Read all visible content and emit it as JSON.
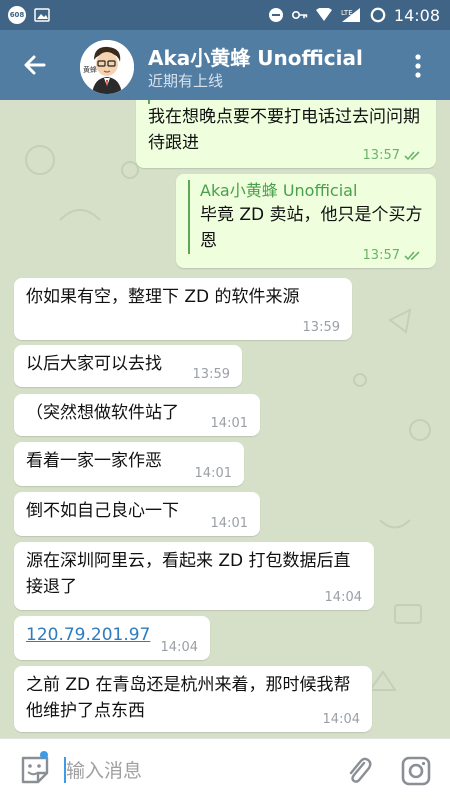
{
  "status_bar": {
    "badge": "608",
    "network": "LTE",
    "time": "14:08"
  },
  "header": {
    "title": "Aka小黄蜂 Unofficial",
    "subtitle": "近期有上线",
    "avatar_label": "黄蜂"
  },
  "messages": [
    {
      "direction": "out",
      "text": "我在想晚点要不要打电话过去问问期待跟进",
      "time": "13:57",
      "status": "read"
    },
    {
      "direction": "out",
      "reply_to": "Aka小黄蜂 Unofficial",
      "text": "毕竟 ZD 卖站，他只是个买方恩",
      "time": "13:57",
      "status": "read"
    },
    {
      "direction": "in",
      "text": "你如果有空，整理下 ZD 的软件来源",
      "time": "13:59"
    },
    {
      "direction": "in",
      "text": "以后大家可以去找",
      "time": "13:59"
    },
    {
      "direction": "in",
      "text": "（突然想做软件站了",
      "time": "14:01"
    },
    {
      "direction": "in",
      "text": "看着一家一家作恶",
      "time": "14:01"
    },
    {
      "direction": "in",
      "text": "倒不如自己良心一下",
      "time": "14:01"
    },
    {
      "direction": "in",
      "text": "源在深圳阿里云，看起来 ZD 打包数据后直接退了",
      "time": "14:04"
    },
    {
      "direction": "in",
      "text": "120.79.201.97",
      "time": "14:04",
      "is_link": true
    },
    {
      "direction": "in",
      "text": "之前 ZD 在青岛还是杭州来着，那时候我帮他维护了点东西",
      "time": "14:04"
    }
  ],
  "composer": {
    "placeholder": "输入消息"
  },
  "colors": {
    "status_bar": "#3f6485",
    "app_bar": "#527da3",
    "chat_bg": "#d6e0c9",
    "outgoing_bubble": "#efffde",
    "incoming_bubble": "#ffffff",
    "check_color": "#6cb36a",
    "link": "#2e7cbf"
  },
  "icons": [
    "back-arrow-icon",
    "more-vert-icon",
    "emoji-sticker-icon",
    "attach-paperclip-icon",
    "camera-icon",
    "double-check-icon"
  ]
}
